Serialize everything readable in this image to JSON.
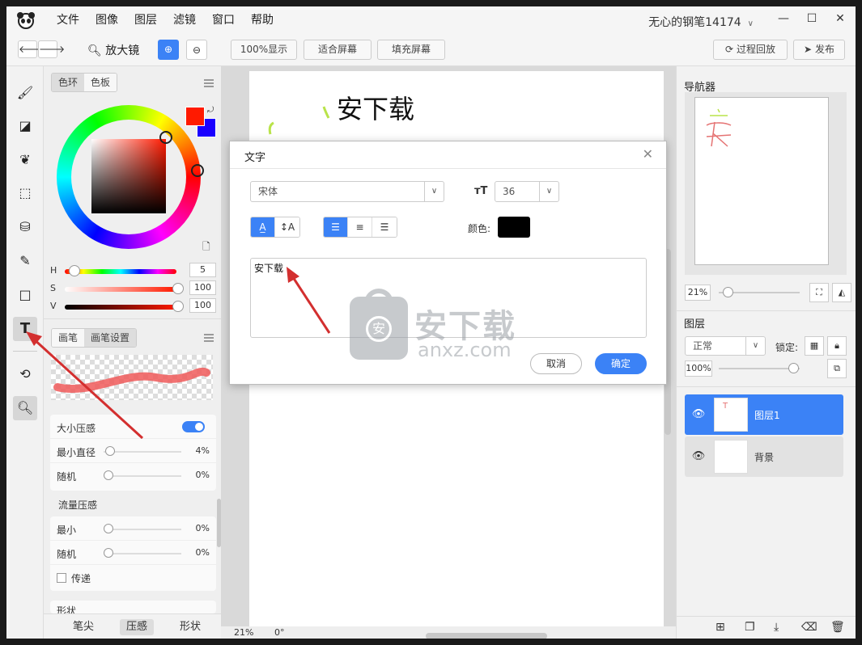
{
  "menu": [
    "文件",
    "图像",
    "图层",
    "滤镜",
    "窗口",
    "帮助"
  ],
  "user": "无心的钢笔14174",
  "toolbar": {
    "zoom_label": "放大镜",
    "show100": "100%显示",
    "fit": "适合屏幕",
    "fill": "填充屏幕",
    "replay": "过程回放",
    "publish": "发布"
  },
  "color_panel": {
    "tabs": [
      "色环",
      "色板"
    ],
    "primary_color": "#ff1a00",
    "secondary_color": "#1a00ff",
    "h_label": "H",
    "h_value": "5",
    "s_label": "S",
    "s_value": "100",
    "v_label": "V",
    "v_value": "100"
  },
  "brush_panel": {
    "tabs": [
      "画笔",
      "画笔设置"
    ],
    "size_pressure": "大小压感",
    "min_diameter": "最小直径",
    "min_diameter_val": "4%",
    "random": "随机",
    "random_val": "0%",
    "flow_pressure": "流量压感",
    "flow_min": "最小",
    "flow_min_val": "0%",
    "flow_random": "随机",
    "flow_random_val": "0%",
    "transfer": "传递",
    "shape_cut": "形状",
    "bottom_tabs": [
      "笔尖",
      "压感",
      "形状"
    ]
  },
  "canvas": {
    "text": "安下载",
    "zoom": "21%",
    "angle": "0°"
  },
  "navigator": {
    "title": "导航器",
    "zoom": "21%"
  },
  "layers": {
    "title": "图层",
    "blend": "正常",
    "lock_label": "锁定:",
    "opacity": "100%",
    "items": [
      {
        "name": "图层1",
        "selected": true
      },
      {
        "name": "背景",
        "selected": false
      }
    ]
  },
  "dialog": {
    "title": "文字",
    "font": "宋体",
    "size": "36",
    "color_label": "颜色:",
    "color": "#000000",
    "text": "安下载",
    "cancel": "取消",
    "ok": "确定"
  },
  "watermark": {
    "big": "安下载",
    "small": "anxz.com"
  }
}
